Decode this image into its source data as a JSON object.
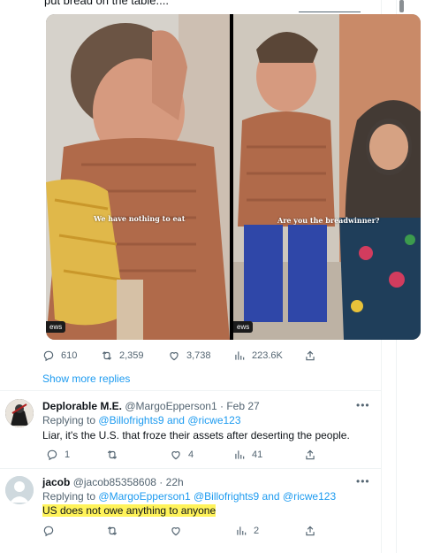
{
  "top_text": "put bread on the table....",
  "media": {
    "caption_left": "We have nothing to eat",
    "caption_right": "Are you the breadwinner?",
    "tag_left": "ews",
    "tag_right": "ews"
  },
  "main_tweet": {
    "replies": "610",
    "retweets": "2,359",
    "likes": "3,738",
    "views": "223.6K"
  },
  "show_more": "Show more replies",
  "replies": [
    {
      "display_name": "Deplorable M.E.",
      "handle": "@MargoEpperson1",
      "sep": "·",
      "time": "Feb 27",
      "replying_prefix": "Replying to",
      "mentions": [
        "@Billofrights9",
        "@ricwe123"
      ],
      "joiner": "and",
      "text": "Liar, it's the U.S. that froze their assets after deserting the people.",
      "stats": {
        "replies": "1",
        "retweets": "",
        "likes": "4",
        "views": "41"
      }
    },
    {
      "display_name": "jacob",
      "handle": "@jacob85358608",
      "sep": "·",
      "time": "22h",
      "replying_prefix": "Replying to",
      "mentions": [
        "@MargoEpperson1",
        "@Billofrights9",
        "@ricwe123"
      ],
      "joiner": "and",
      "text": "US does not owe anything to anyone",
      "stats": {
        "replies": "",
        "retweets": "",
        "likes": "",
        "views": "2"
      }
    }
  ],
  "more_symbol": "•••",
  "colors": {
    "accent": "#1d9bf0",
    "text": "#0f1419",
    "muted": "#536471",
    "highlight": "#fff35a"
  }
}
